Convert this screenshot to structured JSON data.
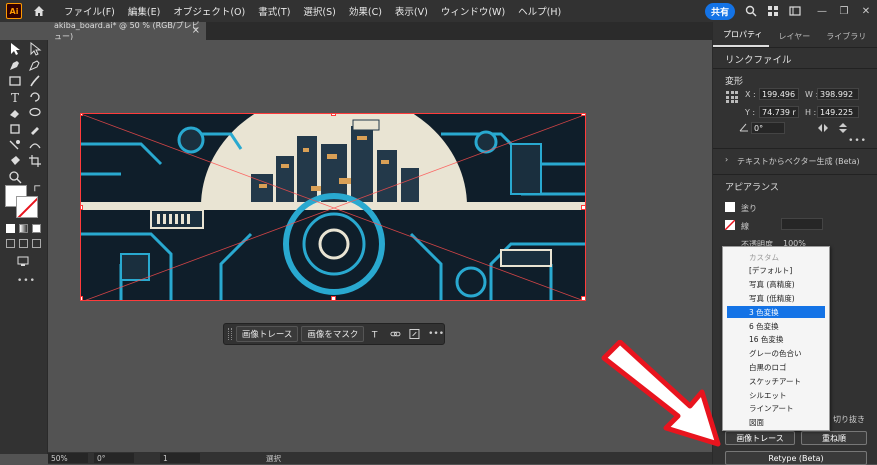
{
  "app": {
    "logo": "Ai"
  },
  "menu": [
    "ファイル(F)",
    "編集(E)",
    "オブジェクト(O)",
    "書式(T)",
    "選択(S)",
    "効果(C)",
    "表示(V)",
    "ウィンドウ(W)",
    "ヘルプ(H)"
  ],
  "header": {
    "share_label": "共有"
  },
  "document": {
    "tab_title": "akiba_board.ai* @ 50 % (RGB/プレビュー)",
    "close_label": "×"
  },
  "context_bar": {
    "trace_label": "画像トレース",
    "mask_label": "画像をマスク",
    "more_label": "•••"
  },
  "status": {
    "zoom": "50%",
    "rotation": "0°",
    "artboard_num": "1",
    "mode": "選択"
  },
  "panel": {
    "tabs": [
      "プロパティ",
      "レイヤー",
      "ライブラリ"
    ],
    "object_type": "リンクファイル",
    "transform_title": "変形",
    "x_label": "X :",
    "x_value": "199.496",
    "y_label": "Y :",
    "y_value": "74.739 r",
    "w_label": "W :",
    "w_value": "398.992",
    "h_label": "H :",
    "h_value": "149.225",
    "angle_value": "0°",
    "text_to_vector": "テキストからベクター生成 (Beta)",
    "appearance_title": "アピアランス",
    "fill_label": "塗り",
    "stroke_label": "線",
    "opacity_label": "不透明度",
    "opacity_value": "100%",
    "crop_label": "切り抜き",
    "trace_button": "画像トレース",
    "arrange_button": "重ね順",
    "retype_button": "Retype (Beta)"
  },
  "trace_presets": {
    "items": [
      "カスタム",
      "[デフォルト]",
      "写真 (高精度)",
      "写真 (低精度)",
      "3 色変換",
      "6 色変換",
      "16 色変換",
      "グレーの色合い",
      "白黒のロゴ",
      "スケッチアート",
      "シルエット",
      "ラインアート",
      "図面"
    ],
    "selected_index": 4
  },
  "colors": {
    "accent": "#1473e6",
    "selection": "#ff3b3b",
    "arrow": "#e8141e"
  }
}
